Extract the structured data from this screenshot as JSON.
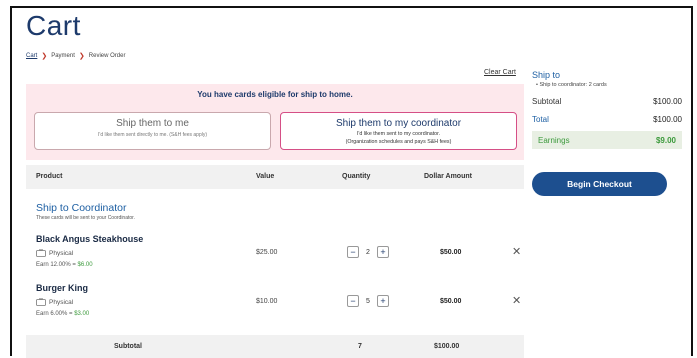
{
  "page_title": "Cart",
  "breadcrumb": {
    "items": [
      "Cart",
      "Payment",
      "Review Order"
    ]
  },
  "clear_cart_label": "Clear Cart",
  "shipping": {
    "heading": "You have cards eligible for ship to home.",
    "option_me": {
      "title": "Ship them to me",
      "sub": "I'd like them sent directly to me. (S&H fees apply)"
    },
    "option_coordinator": {
      "title": "Ship them to my coordinator",
      "sub1": "I'd like them sent to my coordinator.",
      "sub2": "(Organization schedules and pays S&H fees)"
    }
  },
  "table": {
    "headers": {
      "product": "Product",
      "value": "Value",
      "quantity": "Quantity",
      "dollar_amount": "Dollar Amount"
    },
    "section": {
      "title": "Ship to Coordinator",
      "sub": "These cards will be sent to your Coordinator."
    },
    "items": [
      {
        "name": "Black Angus Steakhouse",
        "type": "Physical",
        "earn_prefix": "Earn 12.00% = ",
        "earn_amount": "$6.00",
        "value": "$25.00",
        "qty": "2",
        "dollar": "$50.00"
      },
      {
        "name": "Burger King",
        "type": "Physical",
        "earn_prefix": "Earn 6.00% = ",
        "earn_amount": "$3.00",
        "value": "$10.00",
        "qty": "5",
        "dollar": "$50.00"
      }
    ],
    "subtotal": {
      "label": "Subtotal",
      "qty": "7",
      "amount": "$100.00"
    }
  },
  "summary": {
    "ship_to_label": "Ship to",
    "ship_to_detail": "Ship to coordinator: 2 cards",
    "subtotal_label": "Subtotal",
    "subtotal_value": "$100.00",
    "total_label": "Total",
    "total_value": "$100.00",
    "earnings_label": "Earnings",
    "earnings_value": "$9.00"
  },
  "checkout_label": "Begin Checkout",
  "icons": {
    "minus": "−",
    "plus": "+",
    "remove": "✕",
    "crumb_sep": "❯"
  },
  "colors": {
    "primary": "#1d4f8f",
    "accent_pink": "#d54f86",
    "earn_green": "#3c9a3c"
  }
}
